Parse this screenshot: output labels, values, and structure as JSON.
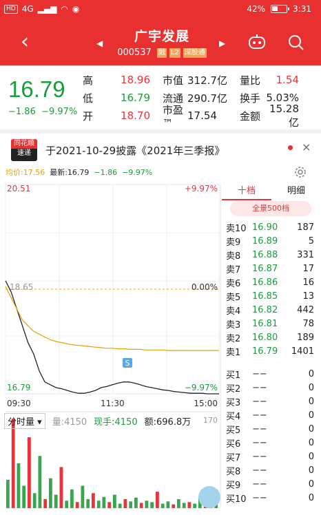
{
  "status": {
    "hd": "HD",
    "net": "4G",
    "battery_pct": "42%",
    "time": "3:31"
  },
  "header": {
    "title": "广宇发展",
    "code": "000537",
    "tags": [
      "融",
      "L2",
      "深股通"
    ]
  },
  "quote": {
    "price": "16.79",
    "change": "−1.86",
    "change_pct": "−9.97%",
    "rows": [
      {
        "l1": "高",
        "v1": "18.96",
        "l2": "市值",
        "v2": "312.7亿",
        "l3": "量比",
        "v3": "1.54"
      },
      {
        "l1": "低",
        "v1": "16.79",
        "l2": "流通",
        "v2": "290.7亿",
        "l3": "换手",
        "v3": "5.03%"
      },
      {
        "l1": "开",
        "v1": "18.70",
        "l2": "市盈™",
        "v2": "17.54",
        "l3": "金额",
        "v3": "15.28亿"
      }
    ]
  },
  "news": {
    "logo_top": "同花顺",
    "logo_bottom": "速递",
    "text": "于2021-10-29披露《2021年三季报》"
  },
  "chart_head": {
    "avg": "均价:17.56",
    "latest": "最新:16.79",
    "chg": "−1.86",
    "pct": "−9.97%"
  },
  "chart_data": {
    "type": "line",
    "title": "",
    "y_labels": {
      "top": "20.51",
      "mid": "18.65",
      "bottom": "16.79"
    },
    "pct_labels": {
      "top": "+9.97%",
      "mid": "0.00%",
      "bottom": "−9.97%"
    },
    "x_ticks": [
      "09:30",
      "11:30",
      "15:00"
    ],
    "ylim": [
      16.79,
      20.51
    ],
    "prev_close": 18.65,
    "series": [
      {
        "values": [
          18.8,
          18.6,
          18.3,
          18.0,
          17.7,
          17.5,
          17.2,
          17.0,
          16.95,
          16.9,
          16.88,
          16.85,
          16.82,
          16.8,
          16.8,
          16.82,
          16.85,
          16.9,
          16.92,
          16.95,
          16.98,
          17.0,
          17.0,
          16.98,
          16.95,
          16.92,
          16.9,
          16.88,
          16.86,
          16.85,
          16.83,
          16.82,
          16.81,
          16.8,
          16.8,
          16.8,
          16.79,
          16.79,
          16.79
        ]
      },
      {
        "values": [
          18.7,
          18.5,
          18.3,
          18.1,
          18.0,
          17.9,
          17.85,
          17.8,
          17.75,
          17.72,
          17.7,
          17.68,
          17.66,
          17.65,
          17.64,
          17.63,
          17.62,
          17.61,
          17.6,
          17.6,
          17.59,
          17.59,
          17.58,
          17.58,
          17.58,
          17.57,
          17.57,
          17.57,
          17.57,
          17.56,
          17.56,
          17.56,
          17.56,
          17.56,
          17.56,
          17.56,
          17.56,
          17.56,
          17.56
        ]
      }
    ],
    "markers": {
      "s_label": "S"
    }
  },
  "volume": {
    "mode_label": "分时量",
    "qty": "量:4150",
    "now": "现手:4150",
    "amount": "额:696.8万",
    "max": "170"
  },
  "book": {
    "tabs": [
      "十档",
      "明细"
    ],
    "all_btn": "全景500档",
    "sell": [
      {
        "label": "卖10",
        "price": "16.90",
        "vol": "187"
      },
      {
        "label": "卖9",
        "price": "16.89",
        "vol": "5"
      },
      {
        "label": "卖8",
        "price": "16.88",
        "vol": "331"
      },
      {
        "label": "卖7",
        "price": "16.87",
        "vol": "17"
      },
      {
        "label": "卖6",
        "price": "16.86",
        "vol": "16"
      },
      {
        "label": "卖5",
        "price": "16.85",
        "vol": "13"
      },
      {
        "label": "卖4",
        "price": "16.82",
        "vol": "442"
      },
      {
        "label": "卖3",
        "price": "16.81",
        "vol": "78"
      },
      {
        "label": "卖2",
        "price": "16.80",
        "vol": "189"
      },
      {
        "label": "卖1",
        "price": "16.79",
        "vol": "1401"
      }
    ],
    "buy": [
      {
        "label": "买1",
        "price": "−−",
        "vol": "0"
      },
      {
        "label": "买2",
        "price": "−−",
        "vol": "0"
      },
      {
        "label": "买3",
        "price": "−−",
        "vol": "0"
      },
      {
        "label": "买4",
        "price": "−−",
        "vol": "0"
      },
      {
        "label": "买5",
        "price": "−−",
        "vol": "0"
      },
      {
        "label": "买6",
        "price": "−−",
        "vol": "0"
      },
      {
        "label": "买7",
        "price": "−−",
        "vol": "0"
      },
      {
        "label": "买8",
        "price": "−−",
        "vol": "0"
      },
      {
        "label": "买9",
        "price": "−−",
        "vol": "0"
      },
      {
        "label": "买10",
        "price": "−−",
        "vol": "0"
      }
    ]
  }
}
